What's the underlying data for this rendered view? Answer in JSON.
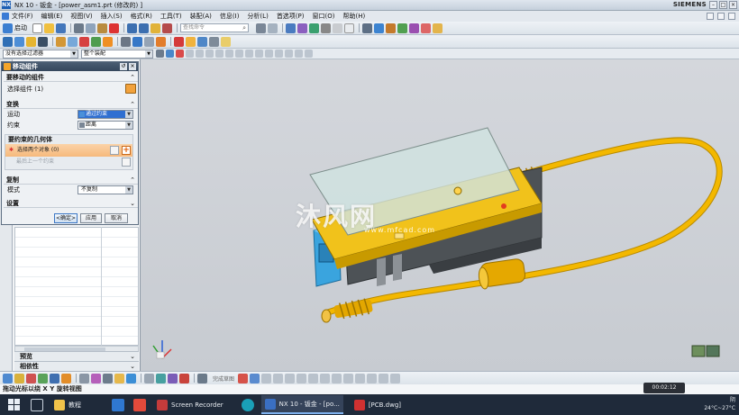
{
  "titlebar": {
    "app_logo": "NX",
    "title": "NX 10 - 钣金 - [power_asm1.prt  (修改的) ]",
    "brand": "SIEMENS",
    "buttons": [
      "–",
      "□",
      "×"
    ]
  },
  "menubar": {
    "items": [
      "文件(F)",
      "编辑(E)",
      "视图(V)",
      "插入(S)",
      "格式(R)",
      "工具(T)",
      "装配(A)",
      "信息(I)",
      "分析(L)",
      "首选项(P)",
      "窗口(O)",
      "帮助(H)"
    ]
  },
  "toolbar1": {
    "start_label": "启动",
    "search_placeholder": "查找命令"
  },
  "toolbar3": {
    "filter_value": "没有选择过滤器",
    "assembly_value": "整个装配"
  },
  "dialog": {
    "title": "移动组件",
    "section_move": "要移动的组件",
    "select_component": "选择组件 (1)",
    "section_transform": "变换",
    "motion_label": "运动",
    "motion_value": "通过约束",
    "constraint_label": "约束",
    "constraint_value": "距离",
    "sub_section": "要约束的几何体",
    "select_two": "选择两个对象 (0)",
    "select_previous": "最后上一个约束",
    "section_copy": "复制",
    "mode_label": "模式",
    "mode_value": "不复制",
    "section_settings": "设置",
    "ok": "<确定>",
    "apply": "应用",
    "cancel": "取消"
  },
  "navigator": {
    "preview": "预览",
    "dependencies": "相依性"
  },
  "viewport": {
    "watermark": "沐风网",
    "watermark_url": "www.mfcad.com",
    "colors": {
      "background": "#ccd0d5",
      "cable": "#f3b800",
      "board": "#f1c21b",
      "cover": "#cfe3e0",
      "housing": "#4d5256",
      "connector": "#3aa4de"
    }
  },
  "bottombar": {
    "snap_label": "完成草图"
  },
  "status": {
    "message": "拖动光标以绕 X Y 旋转视图",
    "timer": "00:02:12"
  },
  "taskbar": {
    "items": [
      {
        "label": "教程",
        "icon": "folder-icon",
        "active": false
      },
      {
        "label": "Screen Recorder",
        "icon": "recorder-icon",
        "active": false
      },
      {
        "label": "NX 10 - 钣金 - [po...",
        "icon": "nx-icon",
        "active": true
      },
      {
        "label": "[PCB.dwg]",
        "icon": "autocad-icon",
        "active": false
      }
    ],
    "weather": "24°C~27°C",
    "tray_char": "阴"
  }
}
